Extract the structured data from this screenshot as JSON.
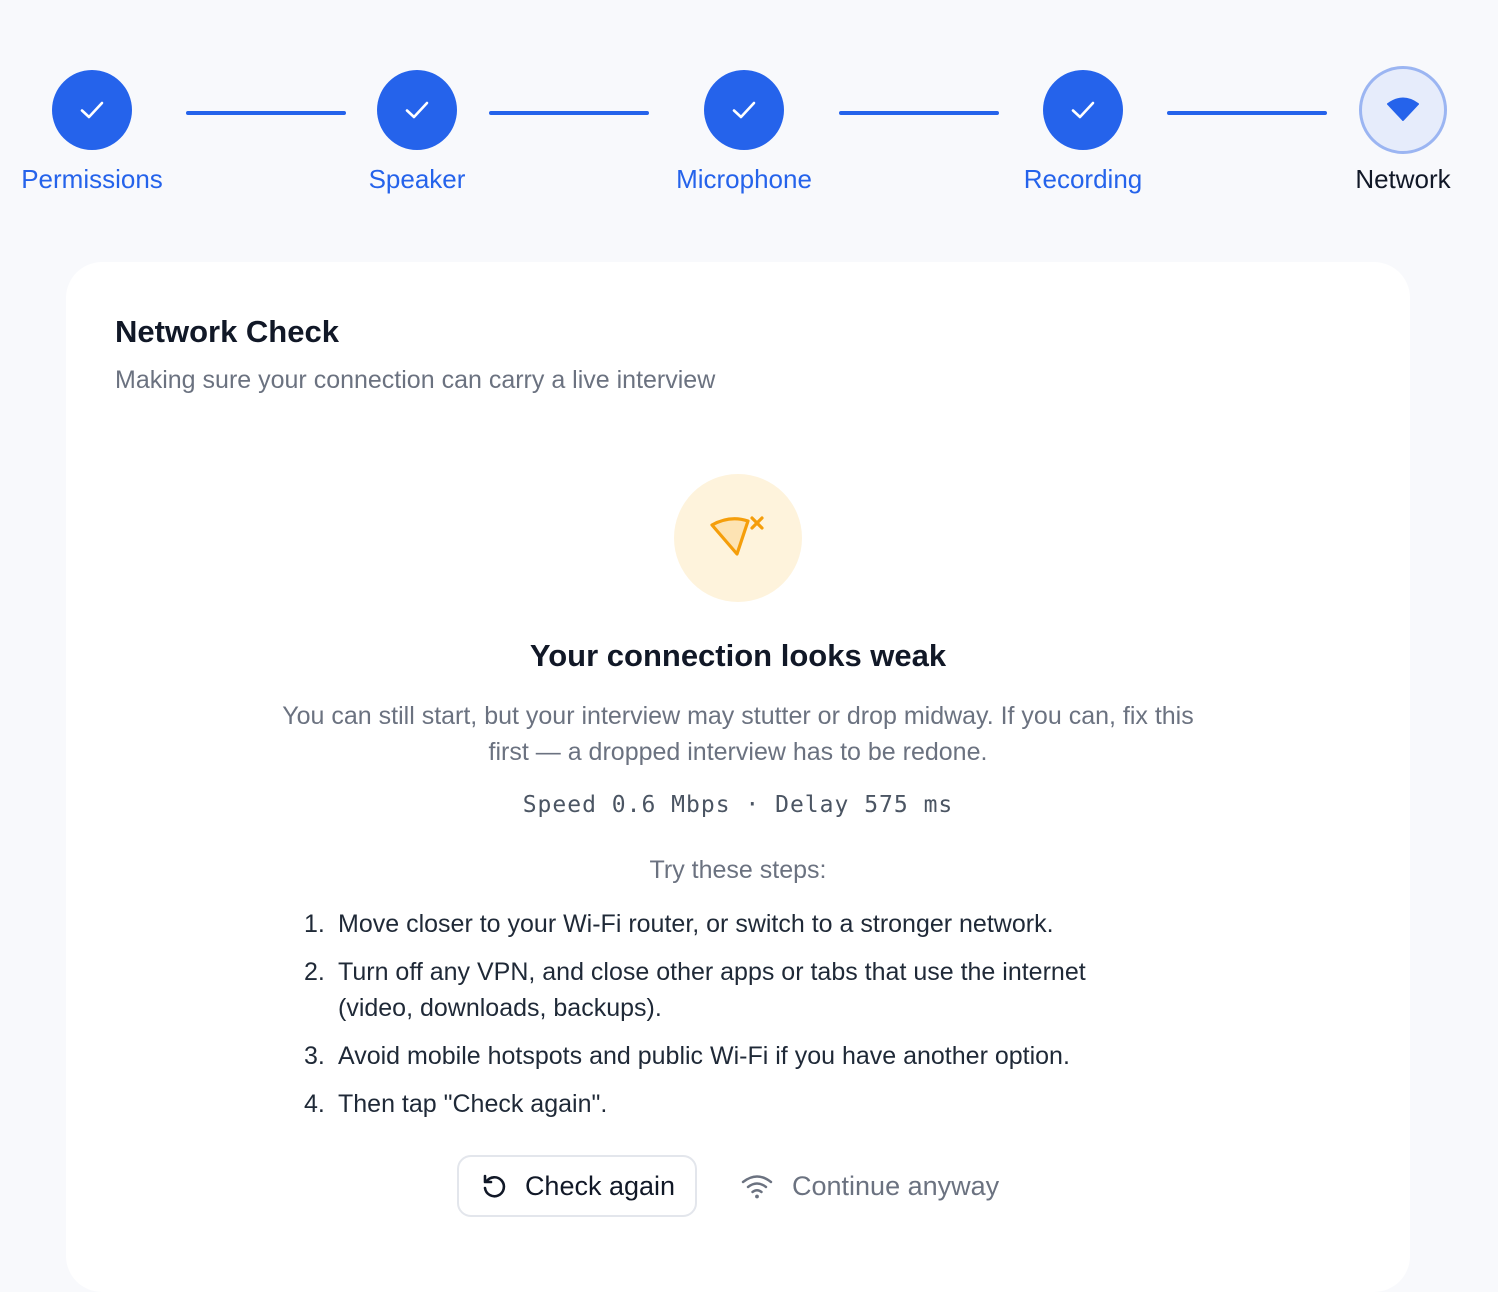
{
  "stepper": {
    "steps": [
      {
        "label": "Permissions",
        "status": "complete",
        "icon": "check-icon"
      },
      {
        "label": "Speaker",
        "status": "complete",
        "icon": "check-icon"
      },
      {
        "label": "Microphone",
        "status": "complete",
        "icon": "check-icon"
      },
      {
        "label": "Recording",
        "status": "complete",
        "icon": "check-icon"
      },
      {
        "label": "Network",
        "status": "current",
        "icon": "wifi-icon"
      }
    ]
  },
  "card": {
    "title": "Network Check",
    "subtitle": "Making sure your connection can carry a live interview"
  },
  "status": {
    "icon": "wifi-off-icon",
    "title": "Your connection looks weak",
    "description": "You can still start, but your interview may stutter or drop midway. If you can, fix this first — a dropped interview has to be redone.",
    "metrics": "Speed 0.6 Mbps · Delay 575 ms"
  },
  "troubleshoot": {
    "heading": "Try these steps:",
    "items": [
      {
        "num": "1.",
        "text": "Move closer to your Wi-Fi router, or switch to a stronger network."
      },
      {
        "num": "2.",
        "text": "Turn off any VPN, and close other apps or tabs that use the internet (video, downloads, backups)."
      },
      {
        "num": "3.",
        "text": "Avoid mobile hotspots and public Wi-Fi if you have another option."
      },
      {
        "num": "4.",
        "text": "Then tap \"Check again\"."
      }
    ]
  },
  "actions": {
    "check_again": "Check again",
    "continue_anyway": "Continue anyway"
  },
  "colors": {
    "accent": "#2563eb",
    "warning": "#f59e0b",
    "warning_bg": "#fef3dc"
  }
}
